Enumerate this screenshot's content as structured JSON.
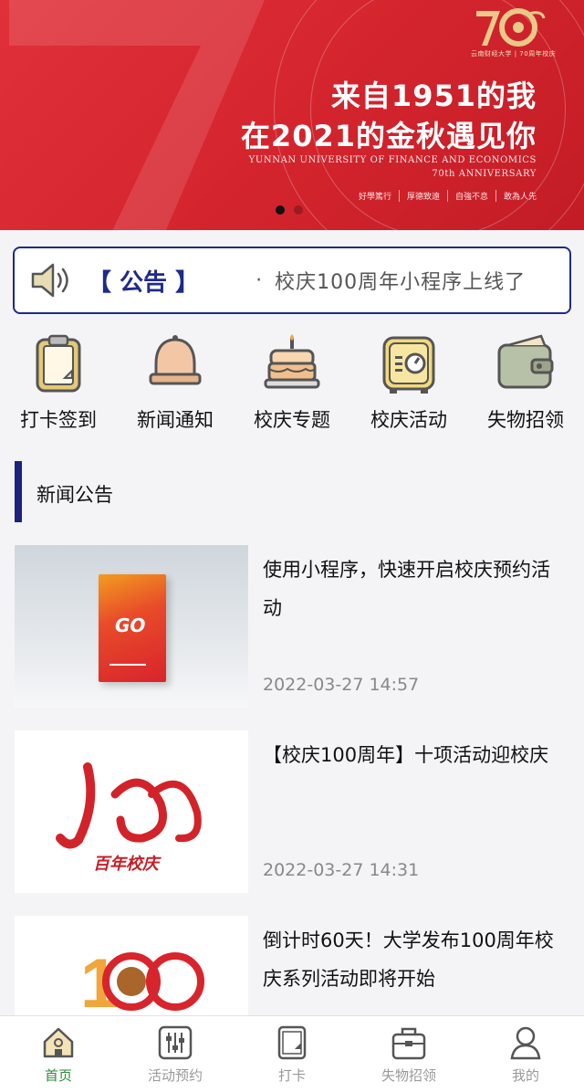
{
  "banner": {
    "logo_caption": "云南财经大学 | 70周年校庆",
    "slogan_line1": "来自1951的我",
    "slogan_line2": "在2021的金秋遇见你",
    "english_line1": "YUNNAN UNIVERSITY OF FINANCE AND ECONOMICS",
    "english_line2": "70th ANNIVERSARY",
    "mottos": [
      "好學篤行",
      "厚德致遠",
      "自強不息",
      "敢為人先"
    ],
    "active_dot": 1,
    "dot_count": 2
  },
  "notice": {
    "tag": "【 公告 】",
    "bullet": "·",
    "message": "校庆100周年小程序上线了"
  },
  "nav": [
    {
      "label": "打卡签到",
      "icon": "clipboard-icon"
    },
    {
      "label": "新闻通知",
      "icon": "bell-icon"
    },
    {
      "label": "校庆专题",
      "icon": "cake-icon"
    },
    {
      "label": "校庆活动",
      "icon": "safe-icon"
    },
    {
      "label": "失物招领",
      "icon": "wallet-icon"
    }
  ],
  "section": {
    "title": "新闻公告"
  },
  "news": [
    {
      "title": "使用小程序，快速开启校庆预约活动",
      "time": "2022-03-27 14:57",
      "thumb_text": "GO"
    },
    {
      "title": "【校庆100周年】十项活动迎校庆",
      "time": "2022-03-27 14:31",
      "thumb_text": "百年校庆"
    },
    {
      "title": "倒计时60天！大学发布100周年校庆系列活动即将开始",
      "time": "",
      "thumb_text": "100"
    }
  ],
  "tabbar": [
    {
      "label": "首页",
      "icon": "home-icon",
      "active": true
    },
    {
      "label": "活动预约",
      "icon": "sliders-icon",
      "active": false
    },
    {
      "label": "打卡",
      "icon": "checkin-icon",
      "active": false
    },
    {
      "label": "失物招领",
      "icon": "bag-icon",
      "active": false
    },
    {
      "label": "我的",
      "icon": "user-icon",
      "active": false
    }
  ],
  "colors": {
    "brand_red": "#d6262f",
    "navy": "#1f2a8a",
    "active_tab": "#2e8b3a"
  }
}
